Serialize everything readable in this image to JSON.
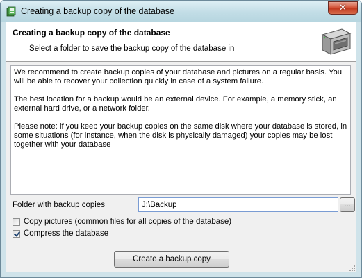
{
  "window": {
    "title": "Creating a backup copy of the database",
    "close_symbol": "✕"
  },
  "header": {
    "title": "Creating a backup copy of the database",
    "subtitle": "Select a folder to save the backup copy of the database in",
    "icon": "hard-drive-icon"
  },
  "info": {
    "paragraphs": [
      "We recommend to create backup copies of your database and pictures on a regular basis. You will be able to recover your collection quickly in case of a system failure.",
      "The best location for a backup would be an external device. For example, a memory stick, an external hard drive, or a network folder.",
      "Please note: if you keep your backup copies on the same disk where your database is stored, in some situations (for instance, when the disk is physically damaged) your copies may be lost together with your database"
    ]
  },
  "folder": {
    "label": "Folder with backup copies",
    "value": "J:\\Backup",
    "browse_label": "..."
  },
  "options": {
    "copy_pictures": {
      "label": "Copy pictures (common files for all copies of the database)",
      "checked": false
    },
    "compress": {
      "label": "Compress the database",
      "checked": true
    }
  },
  "actions": {
    "create_label": "Create a backup copy"
  },
  "colors": {
    "titlebar": "#c2dde6",
    "close_button": "#c23a1f",
    "dialog_bg": "#f0f0f0"
  }
}
